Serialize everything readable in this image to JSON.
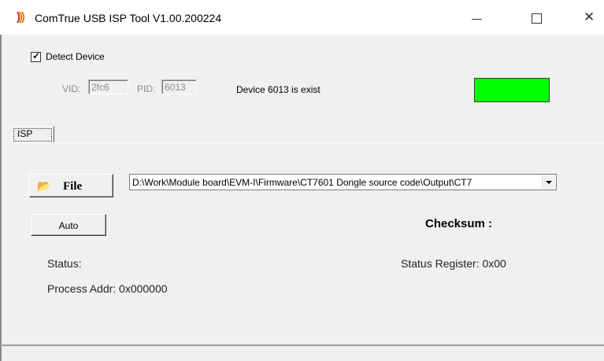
{
  "window": {
    "title": "ComTrue USB ISP Tool V1.00.200224",
    "icon": "signal-waves-icon",
    "controls": {
      "minimize": "minimize-icon",
      "maximize": "maximize-icon",
      "close": "close-icon"
    }
  },
  "device": {
    "detect_label": "Detect Device",
    "detect_checked": true,
    "vid_label": "VID:",
    "vid_value": "2fc6",
    "pid_label": "PID:",
    "pid_value": "6013",
    "message": "Device 6013 is exist",
    "indicator_color": "#00ff00"
  },
  "tabs": [
    {
      "label": "ISP",
      "active": true
    }
  ],
  "isp": {
    "file_button_label": "File",
    "file_icon": "folder-open-icon",
    "file_path": "D:\\Work\\Module board\\EVM-I\\Firmware\\CT7601 Dongle source code\\Output\\CT7",
    "auto_button_label": "Auto",
    "checksum_label": "Checksum :",
    "status_label": "Status:",
    "status_register": "Status Register: 0x00",
    "process_addr": "Process Addr: 0x000000"
  }
}
